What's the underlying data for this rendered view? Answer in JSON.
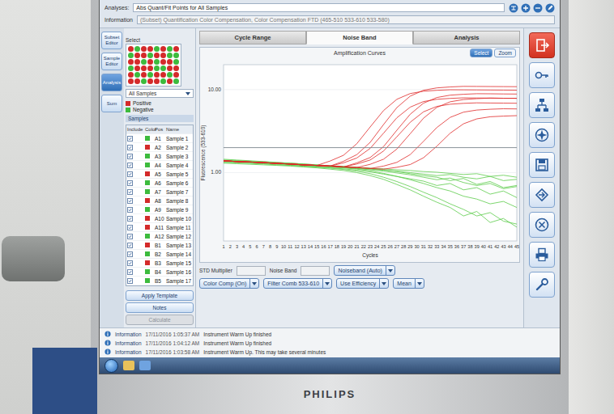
{
  "monitor": {
    "brand": "PHILIPS"
  },
  "header": {
    "analyses_label": "Analyses:",
    "analysis_value": "Abs Quant/Fit Points for All Samples",
    "information_label": "Information",
    "information_value": "(Subset) Quantification Color Compensation, Color Compensation FTD (465-510 533-610 533-580)"
  },
  "nav": [
    {
      "label": "Subset Editor",
      "selected": false
    },
    {
      "label": "Sample Editor",
      "selected": false
    },
    {
      "label": "Analysis",
      "selected": true
    },
    {
      "label": "Sum",
      "selected": false
    }
  ],
  "select_label": "Select",
  "plate": [
    [
      true,
      false,
      true,
      true,
      false,
      true,
      false,
      true
    ],
    [
      false,
      true,
      true,
      false,
      true,
      true,
      false,
      false
    ],
    [
      true,
      true,
      false,
      true,
      false,
      true,
      true,
      false
    ],
    [
      false,
      true,
      true,
      true,
      false,
      false,
      true,
      true
    ],
    [
      true,
      false,
      true,
      false,
      true,
      true,
      false,
      true
    ],
    [
      true,
      true,
      false,
      true,
      true,
      false,
      true,
      false
    ]
  ],
  "filter": "All Samples",
  "legend": [
    {
      "label": "Positive",
      "color": "#d42a2a"
    },
    {
      "label": "Negative",
      "color": "#3dbb3d"
    }
  ],
  "sample_table": {
    "title": "Samples",
    "columns": [
      "Include",
      "Color",
      "Pos",
      "Name"
    ],
    "rows": [
      {
        "include": true,
        "color": "#3dbb3d",
        "pos": "A1",
        "name": "Sample 1"
      },
      {
        "include": true,
        "color": "#d42a2a",
        "pos": "A2",
        "name": "Sample 2"
      },
      {
        "include": true,
        "color": "#3dbb3d",
        "pos": "A3",
        "name": "Sample 3"
      },
      {
        "include": true,
        "color": "#3dbb3d",
        "pos": "A4",
        "name": "Sample 4"
      },
      {
        "include": true,
        "color": "#d42a2a",
        "pos": "A5",
        "name": "Sample 5"
      },
      {
        "include": true,
        "color": "#3dbb3d",
        "pos": "A6",
        "name": "Sample 6"
      },
      {
        "include": true,
        "color": "#3dbb3d",
        "pos": "A7",
        "name": "Sample 7"
      },
      {
        "include": true,
        "color": "#d42a2a",
        "pos": "A8",
        "name": "Sample 8"
      },
      {
        "include": true,
        "color": "#3dbb3d",
        "pos": "A9",
        "name": "Sample 9"
      },
      {
        "include": true,
        "color": "#d42a2a",
        "pos": "A10",
        "name": "Sample 10"
      },
      {
        "include": true,
        "color": "#d42a2a",
        "pos": "A11",
        "name": "Sample 11"
      },
      {
        "include": true,
        "color": "#3dbb3d",
        "pos": "A12",
        "name": "Sample 12"
      },
      {
        "include": true,
        "color": "#d42a2a",
        "pos": "B1",
        "name": "Sample 13"
      },
      {
        "include": true,
        "color": "#3dbb3d",
        "pos": "B2",
        "name": "Sample 14"
      },
      {
        "include": true,
        "color": "#d42a2a",
        "pos": "B3",
        "name": "Sample 15"
      },
      {
        "include": true,
        "color": "#3dbb3d",
        "pos": "B4",
        "name": "Sample 16"
      },
      {
        "include": true,
        "color": "#3dbb3d",
        "pos": "B5",
        "name": "Sample 17"
      }
    ]
  },
  "left_buttons": [
    "Apply Template",
    "Notes",
    "Calculate"
  ],
  "tabs": [
    {
      "label": "Cycle Range",
      "selected": false
    },
    {
      "label": "Noise Band",
      "selected": true
    },
    {
      "label": "Analysis",
      "selected": false
    }
  ],
  "view_buttons": [
    {
      "label": "Select",
      "selected": true
    },
    {
      "label": "Zoom",
      "selected": false
    }
  ],
  "chart": {
    "title": "Amplification Curves",
    "y_title": "Fluorescence (533-610)",
    "y_ticks": [
      {
        "label": "10.00",
        "value": 10
      },
      {
        "label": "1.00",
        "value": 1
      }
    ],
    "x_title": "Cycles",
    "x_ticks": [
      "1",
      "2",
      "3",
      "4",
      "5",
      "6",
      "7",
      "8",
      "9",
      "10",
      "11",
      "12",
      "13",
      "14",
      "15",
      "16",
      "17",
      "18",
      "19",
      "20",
      "21",
      "22",
      "23",
      "24",
      "25",
      "26",
      "27",
      "28",
      "29",
      "30",
      "31",
      "32",
      "33",
      "34",
      "35",
      "36",
      "37",
      "38",
      "39",
      "40",
      "41",
      "42",
      "43",
      "44",
      "45"
    ],
    "cycles": [
      1,
      3,
      5,
      7,
      9,
      11,
      13,
      15,
      17,
      19,
      21,
      23,
      25,
      27,
      29,
      31,
      33,
      35,
      37,
      39,
      41,
      43,
      45
    ],
    "threshold": 2.0,
    "series": [
      {
        "color": "#5ccc4a",
        "values": [
          1.37,
          1.35,
          1.33,
          1.3,
          1.28,
          1.25,
          1.22,
          1.2,
          1.17,
          1.14,
          1.1,
          1.05,
          0.98,
          0.9,
          0.82,
          0.74,
          0.66,
          0.6,
          0.52,
          0.48,
          0.42,
          0.45,
          0.38
        ]
      },
      {
        "color": "#5ccc4a",
        "values": [
          1.42,
          1.4,
          1.37,
          1.35,
          1.32,
          1.3,
          1.27,
          1.24,
          1.21,
          1.18,
          1.15,
          1.12,
          1.08,
          1.03,
          0.97,
          0.92,
          0.88,
          0.8,
          0.85,
          0.72,
          0.78,
          0.66,
          0.7
        ]
      },
      {
        "color": "#5ccc4a",
        "values": [
          1.33,
          1.31,
          1.29,
          1.27,
          1.24,
          1.22,
          1.19,
          1.16,
          1.13,
          1.09,
          1.04,
          0.97,
          0.88,
          0.78,
          0.68,
          0.58,
          0.5,
          0.42,
          0.36,
          0.3,
          0.33,
          0.26,
          0.24
        ]
      },
      {
        "color": "#5ccc4a",
        "values": [
          1.45,
          1.42,
          1.39,
          1.36,
          1.33,
          1.3,
          1.27,
          1.24,
          1.21,
          1.19,
          1.16,
          1.13,
          1.11,
          1.08,
          1.06,
          1.03,
          1.01,
          0.98,
          0.95,
          0.97,
          0.9,
          0.93,
          0.88
        ]
      },
      {
        "color": "#5ccc4a",
        "values": [
          1.35,
          1.33,
          1.31,
          1.28,
          1.26,
          1.23,
          1.2,
          1.17,
          1.14,
          1.11,
          1.07,
          1.02,
          0.96,
          0.9,
          0.84,
          0.79,
          0.7,
          0.74,
          0.62,
          0.66,
          0.55,
          0.6,
          0.5
        ]
      },
      {
        "color": "#5ccc4a",
        "values": [
          1.4,
          1.38,
          1.35,
          1.32,
          1.3,
          1.27,
          1.24,
          1.21,
          1.18,
          1.15,
          1.12,
          1.08,
          1.04,
          0.99,
          0.94,
          0.88,
          0.82,
          0.86,
          0.76,
          0.7,
          0.74,
          0.64,
          0.68
        ]
      },
      {
        "color": "#5ccc4a",
        "values": [
          1.3,
          1.28,
          1.26,
          1.24,
          1.22,
          1.2,
          1.17,
          1.14,
          1.1,
          1.06,
          1.0,
          0.92,
          0.83,
          0.72,
          0.62,
          0.52,
          0.44,
          0.38,
          0.3,
          0.34,
          0.25,
          0.28,
          0.22
        ]
      },
      {
        "color": "#5ccc4a",
        "values": [
          1.38,
          1.36,
          1.34,
          1.31,
          1.29,
          1.26,
          1.23,
          1.2,
          1.18,
          1.15,
          1.12,
          1.1,
          1.07,
          1.04,
          1.0,
          0.96,
          0.92,
          0.95,
          0.88,
          0.84,
          0.9,
          0.8,
          0.83
        ]
      },
      {
        "color": "#e02828",
        "values": [
          1.39,
          1.36,
          1.34,
          1.32,
          1.29,
          1.27,
          1.24,
          1.22,
          1.38,
          1.62,
          2.23,
          3.55,
          5.6,
          7.65,
          8.97,
          9.58,
          9.82,
          9.98,
          9.96,
          9.93,
          9.91,
          9.88,
          9.86
        ]
      },
      {
        "color": "#e02828",
        "values": [
          1.39,
          1.36,
          1.34,
          1.32,
          1.29,
          1.27,
          1.24,
          1.22,
          1.2,
          1.37,
          1.65,
          2.32,
          3.8,
          6.08,
          8.35,
          9.83,
          10.5,
          10.78,
          10.96,
          10.93,
          10.91,
          10.88,
          10.86
        ]
      },
      {
        "color": "#e02828",
        "values": [
          1.39,
          1.36,
          1.34,
          1.32,
          1.29,
          1.27,
          1.24,
          1.22,
          1.2,
          1.31,
          1.5,
          1.96,
          2.99,
          4.58,
          6.16,
          7.19,
          7.65,
          7.84,
          7.96,
          7.93,
          7.91,
          7.88,
          7.86
        ]
      },
      {
        "color": "#e02828",
        "values": [
          1.39,
          1.36,
          1.34,
          1.32,
          1.29,
          1.27,
          1.24,
          1.22,
          1.2,
          1.17,
          1.31,
          1.52,
          2.06,
          3.24,
          5.05,
          6.87,
          8.04,
          8.58,
          8.8,
          8.93,
          8.91,
          8.88,
          8.86
        ]
      },
      {
        "color": "#e02828",
        "values": [
          1.39,
          1.36,
          1.34,
          1.32,
          1.29,
          1.27,
          1.24,
          1.22,
          1.2,
          1.17,
          1.27,
          1.42,
          1.82,
          2.7,
          4.05,
          5.41,
          6.28,
          6.68,
          6.84,
          6.93,
          6.91,
          6.88,
          6.86
        ]
      },
      {
        "color": "#e02828",
        "values": [
          1.39,
          1.36,
          1.34,
          1.32,
          1.29,
          1.27,
          1.24,
          1.22,
          1.2,
          1.17,
          1.15,
          1.26,
          1.45,
          1.92,
          2.94,
          4.53,
          6.11,
          7.14,
          7.61,
          7.79,
          7.91,
          7.88,
          7.86
        ]
      },
      {
        "color": "#e02828",
        "values": [
          1.39,
          1.36,
          1.34,
          1.32,
          1.29,
          1.27,
          1.24,
          1.22,
          1.2,
          1.17,
          1.15,
          1.12,
          1.2,
          1.33,
          1.65,
          2.38,
          3.5,
          4.63,
          5.36,
          5.68,
          5.81,
          5.88,
          5.86
        ]
      },
      {
        "color": "#e02828",
        "values": [
          1.39,
          1.36,
          1.34,
          1.32,
          1.29,
          1.27,
          1.24,
          1.22,
          1.2,
          1.17,
          1.15,
          1.12,
          1.1,
          1.16,
          1.25,
          1.51,
          2.08,
          2.98,
          3.88,
          4.45,
          4.71,
          4.8,
          4.86
        ]
      }
    ]
  },
  "controls": {
    "std_label": "STD Multiplier",
    "noise_label": "Noise Band",
    "noiseband": "Noiseband (Auto)",
    "options": [
      "Color Comp (On)",
      "Filter Comb 533-610",
      "Use Efficiency",
      "Mean"
    ]
  },
  "messages": [
    {
      "level": "Information",
      "time": "17/11/2016 1:05:37 AM",
      "text": "Instrument Warm Up finished"
    },
    {
      "level": "Information",
      "time": "17/11/2016 1:04:12 AM",
      "text": "Instrument Warm Up finished"
    },
    {
      "level": "Information",
      "time": "17/11/2016 1:03:58 AM",
      "text": "Instrument Warm Up. This may take several minutes"
    }
  ]
}
